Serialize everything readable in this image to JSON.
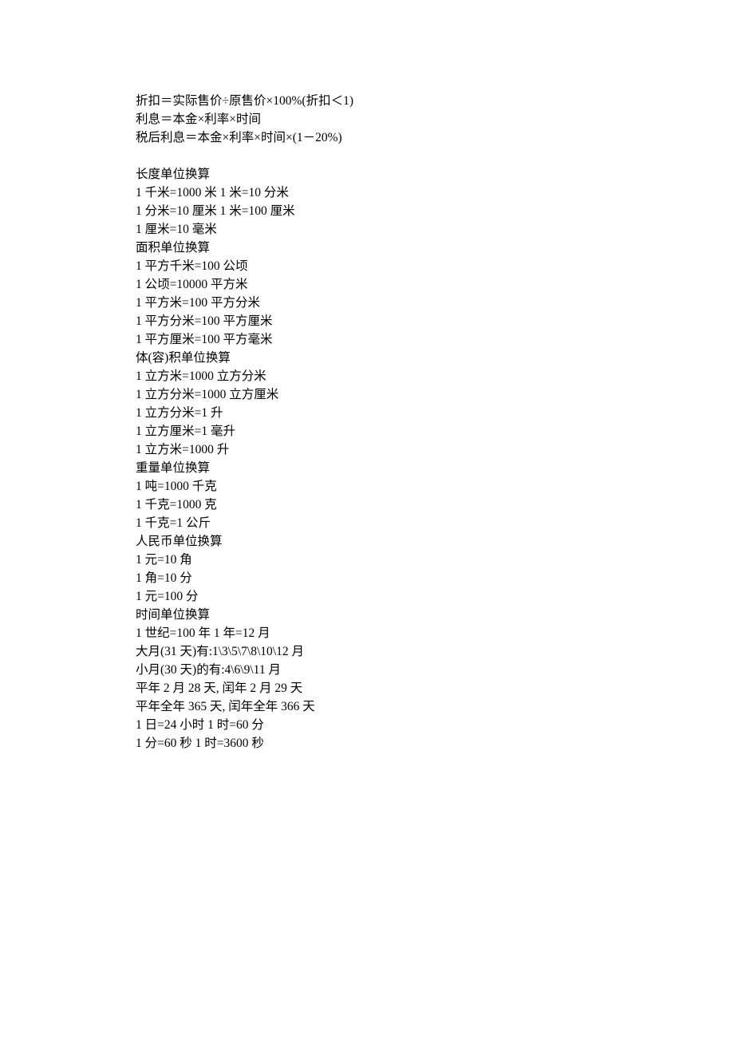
{
  "para1": [
    "折扣＝实际售价÷原售价×100%(折扣＜1)",
    "利息＝本金×利率×时间",
    "税后利息＝本金×利率×时间×(1－20%)"
  ],
  "para2": [
    "长度单位换算",
    "1 千米=1000 米  1 米=10 分米",
    "1 分米=10 厘米  1 米=100 厘米",
    "1 厘米=10 毫米",
    "面积单位换算",
    "1 平方千米=100 公顷",
    "1 公顷=10000 平方米",
    "1 平方米=100 平方分米",
    "1 平方分米=100 平方厘米",
    "1 平方厘米=100 平方毫米",
    "体(容)积单位换算",
    "1 立方米=1000 立方分米",
    "1 立方分米=1000 立方厘米",
    "1 立方分米=1 升",
    "1 立方厘米=1 毫升",
    "1 立方米=1000 升",
    "重量单位换算",
    "1 吨=1000  千克",
    "1 千克=1000 克",
    "1 千克=1 公斤",
    "人民币单位换算",
    "1 元=10 角",
    "1 角=10 分",
    "1 元=100 分",
    "时间单位换算",
    "1 世纪=100 年  1 年=12 月",
    "大月(31 天)有:1\\3\\5\\7\\8\\10\\12 月",
    "小月(30 天)的有:4\\6\\9\\11 月",
    "平年 2 月 28 天,  闰年 2 月 29 天",
    "平年全年 365 天,  闰年全年 366 天",
    "1 日=24 小时  1 时=60 分",
    "1 分=60 秒  1 时=3600 秒"
  ]
}
